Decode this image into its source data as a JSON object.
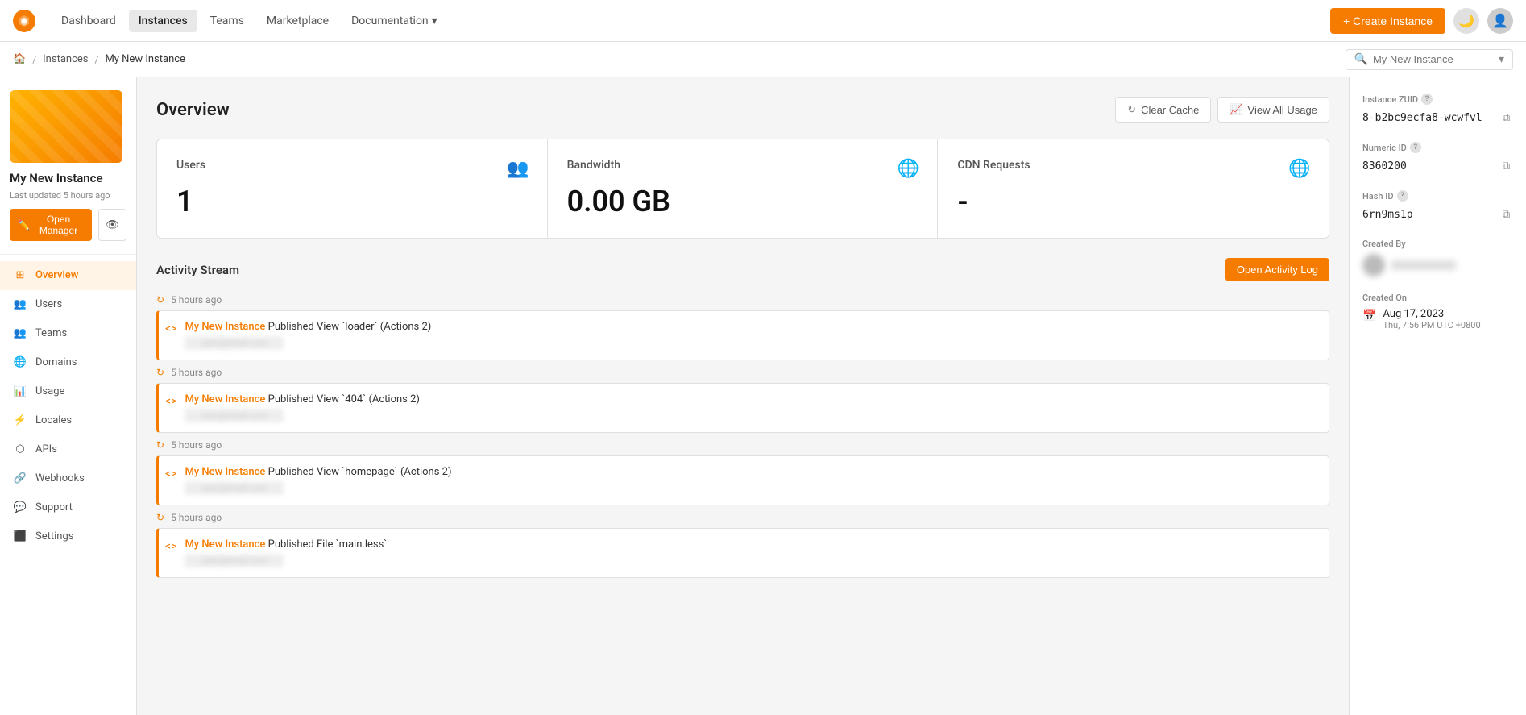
{
  "nav": {
    "logo_alt": "Zesty logo",
    "links": [
      {
        "label": "Dashboard",
        "active": false,
        "id": "dashboard"
      },
      {
        "label": "Instances",
        "active": true,
        "id": "instances"
      },
      {
        "label": "Teams",
        "active": false,
        "id": "teams"
      },
      {
        "label": "Marketplace",
        "active": false,
        "id": "marketplace"
      },
      {
        "label": "Documentation",
        "active": false,
        "id": "documentation",
        "dropdown": true
      }
    ],
    "create_instance_label": "+ Create Instance"
  },
  "breadcrumb": {
    "home_label": "🏠",
    "separator": "/",
    "instances_label": "Instances",
    "current_label": "My New Instance",
    "search_placeholder": "My New Instance"
  },
  "sidebar": {
    "instance_name": "My New Instance",
    "last_updated": "Last updated 5 hours ago",
    "open_manager_label": "Open Manager",
    "nav_items": [
      {
        "id": "overview",
        "label": "Overview",
        "active": true
      },
      {
        "id": "users",
        "label": "Users",
        "active": false
      },
      {
        "id": "teams",
        "label": "Teams",
        "active": false
      },
      {
        "id": "domains",
        "label": "Domains",
        "active": false
      },
      {
        "id": "usage",
        "label": "Usage",
        "active": false
      },
      {
        "id": "locales",
        "label": "Locales",
        "active": false
      },
      {
        "id": "apis",
        "label": "APIs",
        "active": false
      },
      {
        "id": "webhooks",
        "label": "Webhooks",
        "active": false
      },
      {
        "id": "support",
        "label": "Support",
        "active": false
      },
      {
        "id": "settings",
        "label": "Settings",
        "active": false
      }
    ]
  },
  "overview": {
    "title": "Overview",
    "clear_cache_label": "Clear Cache",
    "view_all_usage_label": "View All Usage",
    "stats": [
      {
        "label": "Users",
        "value": "1",
        "icon": "users-icon",
        "icon_color": "#f57c00"
      },
      {
        "label": "Bandwidth",
        "value": "0.00 GB",
        "icon": "globe-icon",
        "icon_color": "#1976d2"
      },
      {
        "label": "CDN Requests",
        "value": "-",
        "icon": "cdn-globe-icon",
        "icon_color": "#9c27b0"
      }
    ]
  },
  "activity": {
    "section_title": "Activity Stream",
    "open_log_label": "Open Activity Log",
    "groups": [
      {
        "timestamp": "5 hours ago",
        "items": [
          {
            "instance_link": "My New Instance",
            "text": " Published View `loader` (Actions 2)",
            "sub": "blurred-user-info"
          }
        ]
      },
      {
        "timestamp": "5 hours ago",
        "items": [
          {
            "instance_link": "My New Instance",
            "text": " Published View `404` (Actions 2)",
            "sub": "blurred-user-info"
          }
        ]
      },
      {
        "timestamp": "5 hours ago",
        "items": [
          {
            "instance_link": "My New Instance",
            "text": " Published View `homepage` (Actions 2)",
            "sub": "blurred-user-info"
          }
        ]
      },
      {
        "timestamp": "5 hours ago",
        "items": [
          {
            "instance_link": "My New Instance",
            "text": " Published File `main.less`",
            "sub": "blurred-user-info"
          }
        ]
      }
    ]
  },
  "instance_info": {
    "instance_zuid_label": "Instance ZUID",
    "instance_zuid_value": "8-b2bc9ecfa8-wcwfvl",
    "numeric_id_label": "Numeric ID",
    "numeric_id_value": "8360200",
    "hash_id_label": "Hash ID",
    "hash_id_value": "6rn9ms1p",
    "created_by_label": "Created By",
    "created_on_label": "Created On",
    "created_on_date": "Aug 17, 2023",
    "created_on_day": "Thu, 7:56 PM UTC +0800",
    "q_tooltip": "?"
  }
}
